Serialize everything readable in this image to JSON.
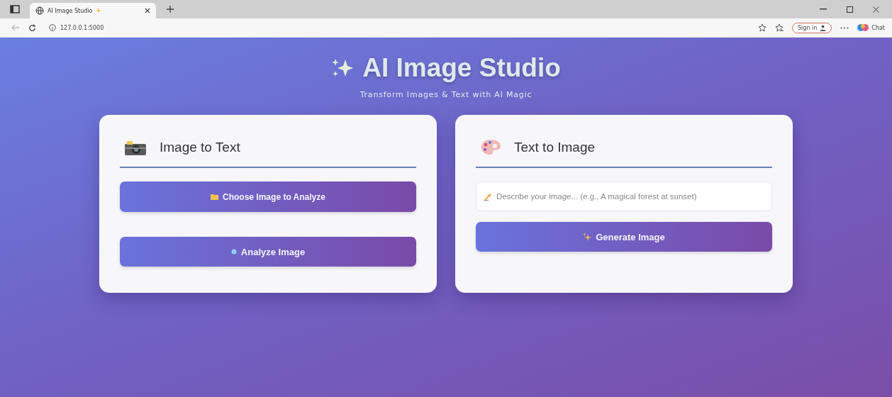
{
  "browser": {
    "tab_title": "AI Image Studio",
    "url": "127.0.0.1:5000",
    "sign_in": "Sign in",
    "chat": "Chat"
  },
  "header": {
    "title": "AI Image Studio",
    "subtitle": "Transform Images & Text with AI Magic"
  },
  "panels": [
    {
      "kind": "camera",
      "title": "Image to Text",
      "controls": [
        {
          "kind": "choose",
          "label": "Choose Image to Analyze"
        },
        {
          "kind": "analyze",
          "label": "Analyze Image"
        }
      ]
    },
    {
      "kind": "palette",
      "title": "Text to Image",
      "controls": [
        {
          "kind": "prompt",
          "placeholder": "Describe your image... (e.g., A magical forest at sunset)"
        },
        {
          "kind": "generate",
          "label": "Generate Image"
        }
      ]
    }
  ]
}
